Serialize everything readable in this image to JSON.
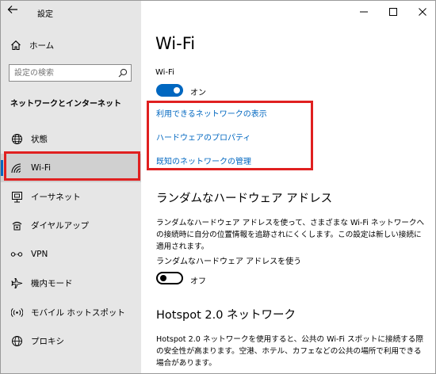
{
  "app": {
    "title": "設定",
    "back_icon": "back-arrow-icon"
  },
  "window_controls": {
    "minimize": "─",
    "maximize": "☐",
    "close": "✕"
  },
  "sidebar": {
    "home_label": "ホーム",
    "search_placeholder": "設定の検索",
    "section_title": "ネットワークとインターネット",
    "items": [
      {
        "label": "状態",
        "icon": "globe-status-icon"
      },
      {
        "label": "Wi-Fi",
        "icon": "wifi-icon",
        "selected": true
      },
      {
        "label": "イーサネット",
        "icon": "ethernet-icon"
      },
      {
        "label": "ダイヤルアップ",
        "icon": "dialup-icon"
      },
      {
        "label": "VPN",
        "icon": "vpn-icon"
      },
      {
        "label": "機内モード",
        "icon": "airplane-icon"
      },
      {
        "label": "モバイル ホットスポット",
        "icon": "hotspot-icon"
      },
      {
        "label": "プロキシ",
        "icon": "globe-proxy-icon"
      }
    ]
  },
  "main": {
    "title": "Wi-Fi",
    "wifi_label": "Wi-Fi",
    "wifi_toggle": {
      "state": "on",
      "text": "オン"
    },
    "links": [
      "利用できるネットワークの表示",
      "ハードウェアのプロパティ",
      "既知のネットワークの管理"
    ],
    "random_hw": {
      "heading": "ランダムなハードウェア アドレス",
      "description": "ランダムなハードウェア アドレスを使って、さまざまな Wi-Fi ネットワークへの接続時に自分の位置情報を追跡されにくくします。この設定は新しい接続に適用されます。",
      "setting_label": "ランダムなハードウェア アドレスを使う",
      "toggle": {
        "state": "off",
        "text": "オフ"
      }
    },
    "hotspot2": {
      "heading": "Hotspot 2.0 ネットワーク",
      "description": "Hotspot 2.0 ネットワークを使用すると、公共の Wi-Fi スポットに接続する際の安全性が高まります。空港、ホテル、カフェなどの公共の場所で利用できる場合があります。"
    }
  },
  "colors": {
    "accent": "#0067c0",
    "highlight_box": "#e02020",
    "sidebar_bg": "#e6e6e6"
  }
}
